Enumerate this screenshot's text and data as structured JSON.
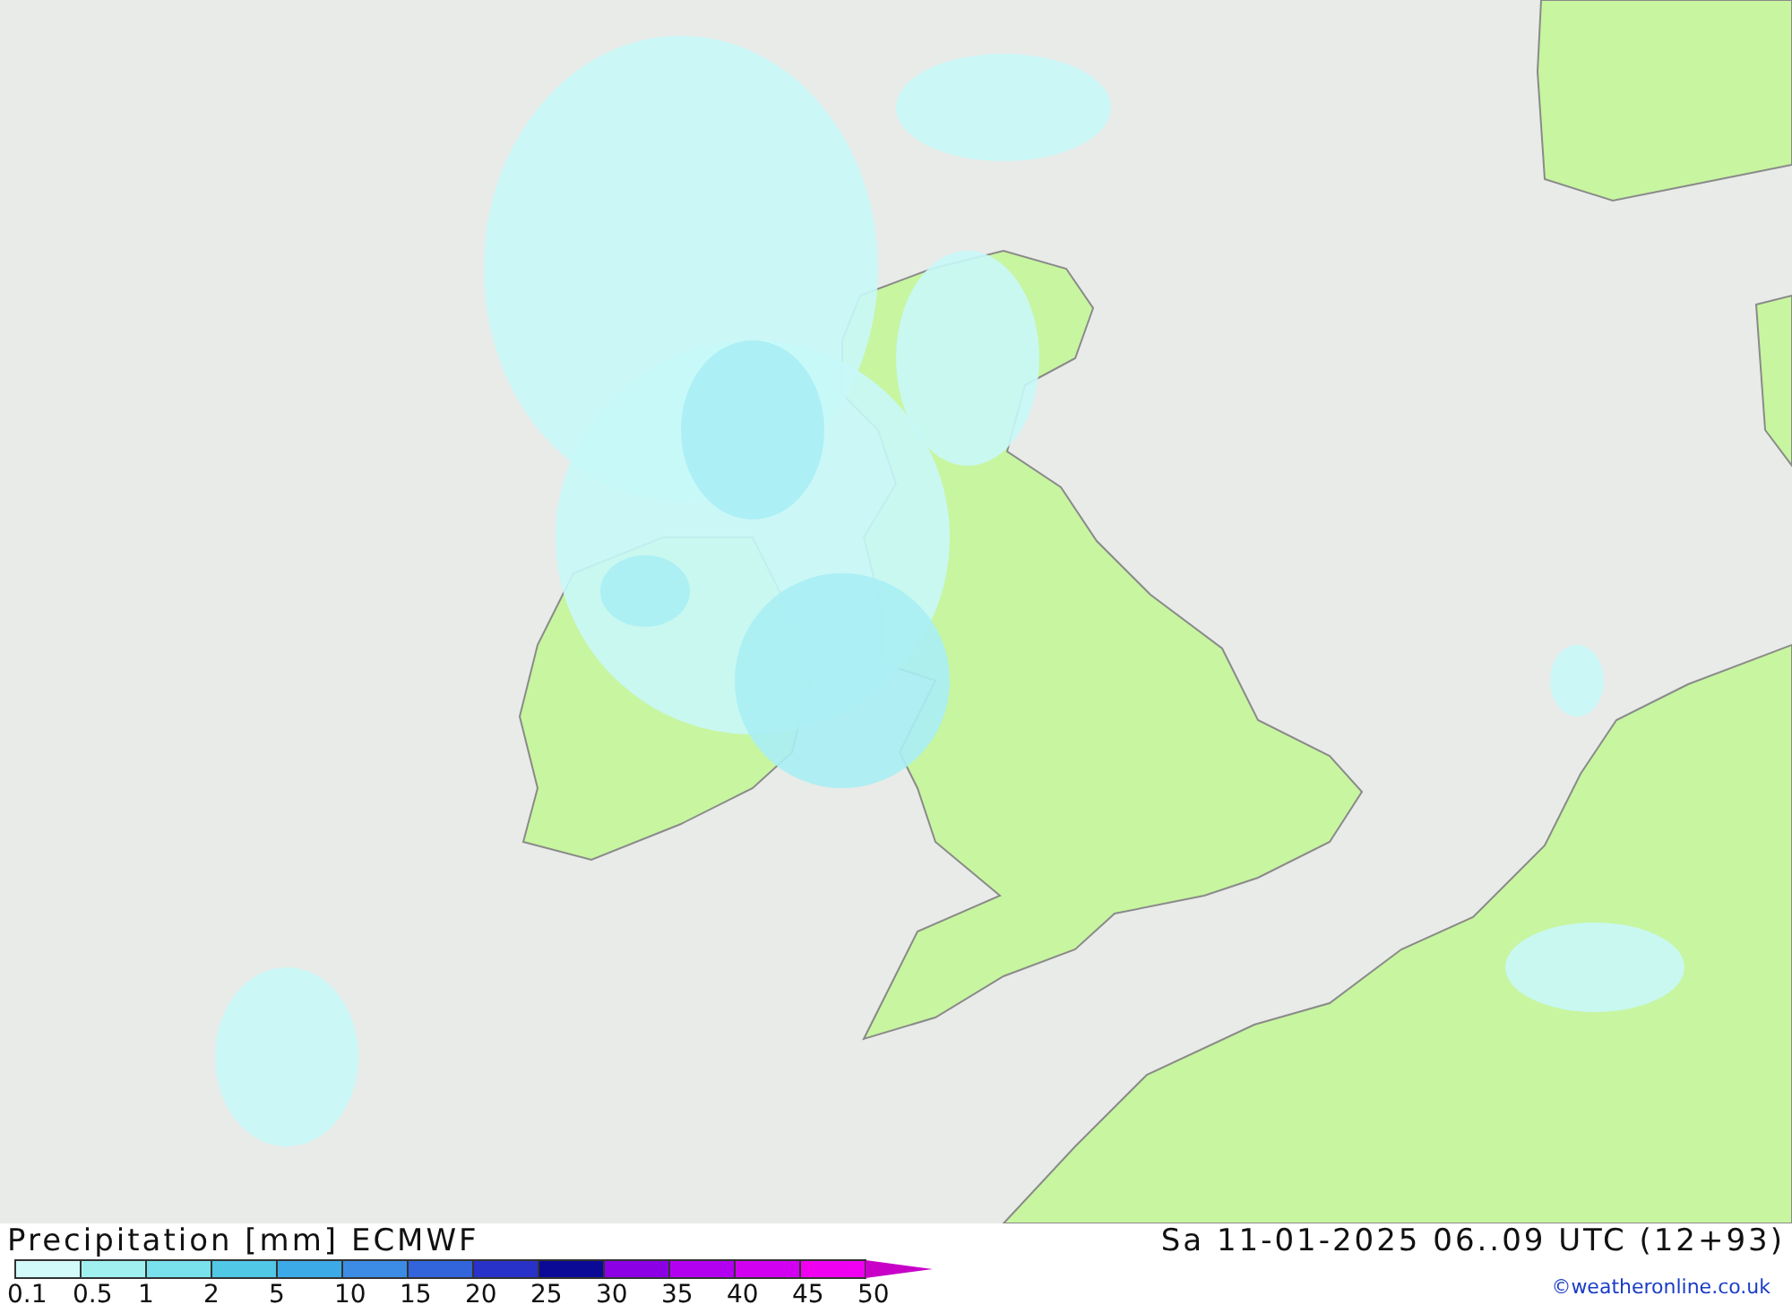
{
  "map": {
    "title": "Precipitation [mm] ECMWF",
    "valid_time": "Sa 11-01-2025 06..09 UTC (12+93)"
  },
  "legend": {
    "swatches": [
      {
        "color": "#d2fafa"
      },
      {
        "color": "#a0f0f0"
      },
      {
        "color": "#78e1ec"
      },
      {
        "color": "#50c8e6"
      },
      {
        "color": "#3caae6"
      },
      {
        "color": "#3c8ce6"
      },
      {
        "color": "#3264dc"
      },
      {
        "color": "#2832c8"
      },
      {
        "color": "#0a0a96"
      },
      {
        "color": "#8c00e6"
      },
      {
        "color": "#b400f0"
      },
      {
        "color": "#d200f0"
      },
      {
        "color": "#f000f0"
      },
      {
        "color": "#c800c8"
      }
    ],
    "labels": [
      "0.1",
      "0.5",
      "1",
      "2",
      "5",
      "10",
      "15",
      "20",
      "25",
      "30",
      "35",
      "40",
      "45",
      "50"
    ]
  },
  "credit": "©weatheronline.co.uk"
}
